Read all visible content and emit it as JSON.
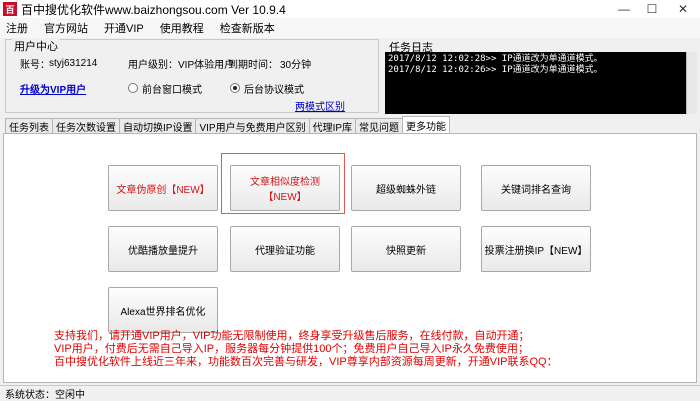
{
  "window": {
    "logo_text": "百",
    "title": "百中搜优化软件www.baizhongsou.com Ver 10.9.4",
    "minimize": "—",
    "maximize": "☐",
    "close": "✕"
  },
  "menu": [
    "注册",
    "官方网站",
    "开通VIP",
    "使用教程",
    "检查新版本"
  ],
  "user_center": {
    "title": "用户中心",
    "account_label": "账号：",
    "account_value": "styj631214",
    "level_label": "用户级别：",
    "level_value": "VIP体验用户",
    "expire_label": "到期时间：",
    "expire_value": "30分钟",
    "upgrade_link": "升级为VIP用户",
    "mode_front": "前台窗口模式",
    "mode_back": "后台协议模式",
    "selected_mode": "后台协议模式",
    "diff_link": "两模式区别"
  },
  "task_log": {
    "title": "任务日志",
    "lines": [
      "2017/8/12 12:02:28>> IP通道改为单通道模式。",
      "2017/8/12 12:02:26>> IP通道改为单通道模式。"
    ]
  },
  "tabs": [
    "任务列表",
    "任务次数设置",
    "自动切换IP设置",
    "VIP用户与免费用户区别",
    "代理IP库",
    "常见问题",
    "更多功能"
  ],
  "active_tab": "更多功能",
  "buttons": {
    "article_pseudo": "文章伪原创【NEW】",
    "article_similarity": "文章相似度检测【NEW】",
    "spider_links": "超级蜘蛛外链",
    "keyword_rank": "关键词排名查询",
    "youku_boost": "优酷播放量提升",
    "proxy_verify": "代理验证功能",
    "snapshot_update": "快照更新",
    "register_ip": "投票注册换IP【NEW】",
    "alexa_rank": "Alexa世界排名优化"
  },
  "notice": [
    "支持我们，请开通VIP用户，VIP功能无限制使用，终身享受升级售后服务，在线付款，自动开通；",
    "VIP用户，付费后无需自己导入IP，服务器每分钟提供100个；免费用户自己导入IP永久免费使用；",
    "百中搜优化软件上线近三年来，功能数百次完善与研发，VIP尊享内部资源每周更新，开通VIP联系QQ："
  ],
  "status": "系统状态：空闲中",
  "colors": {
    "notice_red": "#e00000",
    "link_blue": "#0000cc",
    "log_bg": "#000000"
  }
}
